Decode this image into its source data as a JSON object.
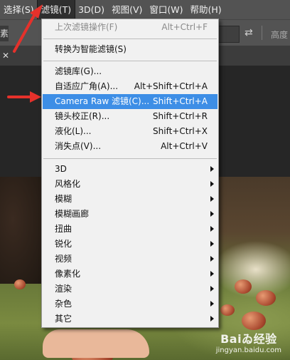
{
  "menubar": {
    "items": [
      {
        "label": "选择(S)"
      },
      {
        "label": "滤镜(T)"
      },
      {
        "label": "3D(D)"
      },
      {
        "label": "视图(V)"
      },
      {
        "label": "窗口(W)"
      },
      {
        "label": "帮助(H)"
      }
    ]
  },
  "options": {
    "left_fragment": "素",
    "height_label": "高度"
  },
  "filter_menu": {
    "last_filter": {
      "label": "上次滤镜操作(F)",
      "shortcut": "Alt+Ctrl+F"
    },
    "convert_smart": {
      "label": "转换为智能滤镜(S)"
    },
    "filter_gallery": {
      "label": "滤镜库(G)..."
    },
    "adaptive_wide_angle": {
      "label": "自适应广角(A)...",
      "shortcut": "Alt+Shift+Ctrl+A"
    },
    "camera_raw": {
      "label": "Camera Raw 滤镜(C)...",
      "shortcut": "Shift+Ctrl+A"
    },
    "lens_correction": {
      "label": "镜头校正(R)...",
      "shortcut": "Shift+Ctrl+R"
    },
    "liquify": {
      "label": "液化(L)...",
      "shortcut": "Shift+Ctrl+X"
    },
    "vanishing_point": {
      "label": "消失点(V)...",
      "shortcut": "Alt+Ctrl+V"
    },
    "submenus": [
      {
        "label": "3D"
      },
      {
        "label": "风格化"
      },
      {
        "label": "模糊"
      },
      {
        "label": "模糊画廊"
      },
      {
        "label": "扭曲"
      },
      {
        "label": "锐化"
      },
      {
        "label": "视频"
      },
      {
        "label": "像素化"
      },
      {
        "label": "渲染"
      },
      {
        "label": "杂色"
      },
      {
        "label": "其它"
      }
    ]
  },
  "watermark": {
    "title": "Baiゐ经验",
    "subtitle": "jingyan.baidu.com"
  },
  "colors": {
    "menubar": "#535353",
    "menu_bg": "#f1f1f1",
    "highlight": "#3d8ee6",
    "annotation": "#e5312b"
  }
}
